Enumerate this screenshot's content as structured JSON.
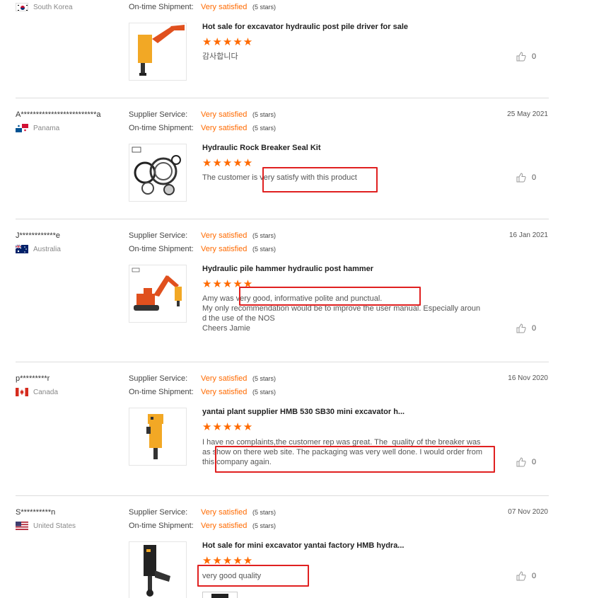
{
  "colors": {
    "accent": "#ff6a00",
    "highlight": "#e02020",
    "divider": "#dcdcdc"
  },
  "reviews": [
    {
      "user": "",
      "country": "South Korea",
      "flag_icon": "south-korea-flag-icon",
      "date": "",
      "ratings": [
        {
          "label": "On-time Shipment:",
          "value": "Very satisfied",
          "stars_text": "(5 stars)"
        }
      ],
      "product": {
        "title": "Hot sale for excavator hydraulic post pile driver for sale",
        "image_icon": "pile-driver-product-image",
        "stars": "★★★★★",
        "comment": "감사합니다"
      },
      "likes": "0"
    },
    {
      "user": "A*************************a",
      "country": "Panama",
      "flag_icon": "panama-flag-icon",
      "date": "25 May 2021",
      "ratings": [
        {
          "label": "Supplier Service:",
          "value": "Very satisfied",
          "stars_text": "(5 stars)"
        },
        {
          "label": "On-time Shipment:",
          "value": "Very satisfied",
          "stars_text": "(5 stars)"
        }
      ],
      "product": {
        "title": "Hydraulic Rock Breaker Seal Kit",
        "image_icon": "seal-kit-product-image",
        "stars": "★★★★★",
        "comment": "The customer is very satisfy with this product"
      },
      "likes": "0"
    },
    {
      "user": "J************e",
      "country": "Australia",
      "flag_icon": "australia-flag-icon",
      "date": "16 Jan 2021",
      "ratings": [
        {
          "label": "Supplier Service:",
          "value": "Very satisfied",
          "stars_text": "(5 stars)"
        },
        {
          "label": "On-time Shipment:",
          "value": "Very satisfied",
          "stars_text": "(5 stars)"
        }
      ],
      "product": {
        "title": "Hydraulic pile hammer hydraulic post hammer",
        "image_icon": "excavator-hammer-product-image",
        "stars": "★★★★★",
        "comment": "Amy was very good, informative polite and punctual.\nMy only recommendation would be to improve the user manual. Especially aroun\nd the use of the NOS\nCheers Jamie"
      },
      "likes": "0"
    },
    {
      "user": "p*********r",
      "country": "Canada",
      "flag_icon": "canada-flag-icon",
      "date": "16 Nov 2020",
      "ratings": [
        {
          "label": "Supplier Service:",
          "value": "Very satisfied",
          "stars_text": "(5 stars)"
        },
        {
          "label": "On-time Shipment:",
          "value": "Very satisfied",
          "stars_text": "(5 stars)"
        }
      ],
      "product": {
        "title": "yantai plant supplier HMB 530 SB30 mini excavator h...",
        "image_icon": "mini-breaker-product-image",
        "stars": "★★★★★",
        "comment": "I have no complaints,the customer rep was great. The  quality of the breaker was\nas show on there web site. The packaging was very well done. I would order from\nthis company again."
      },
      "likes": "0"
    },
    {
      "user": "S**********n",
      "country": "United States",
      "flag_icon": "united-states-flag-icon",
      "date": "07 Nov 2020",
      "ratings": [
        {
          "label": "Supplier Service:",
          "value": "Very satisfied",
          "stars_text": "(5 stars)"
        },
        {
          "label": "On-time Shipment:",
          "value": "Very satisfied",
          "stars_text": "(5 stars)"
        }
      ],
      "product": {
        "title": "Hot sale for mini excavator yantai factory HMB hydra...",
        "image_icon": "post-driver-product-image",
        "stars": "★★★★★",
        "comment": "very good quality"
      },
      "likes": "0"
    }
  ]
}
